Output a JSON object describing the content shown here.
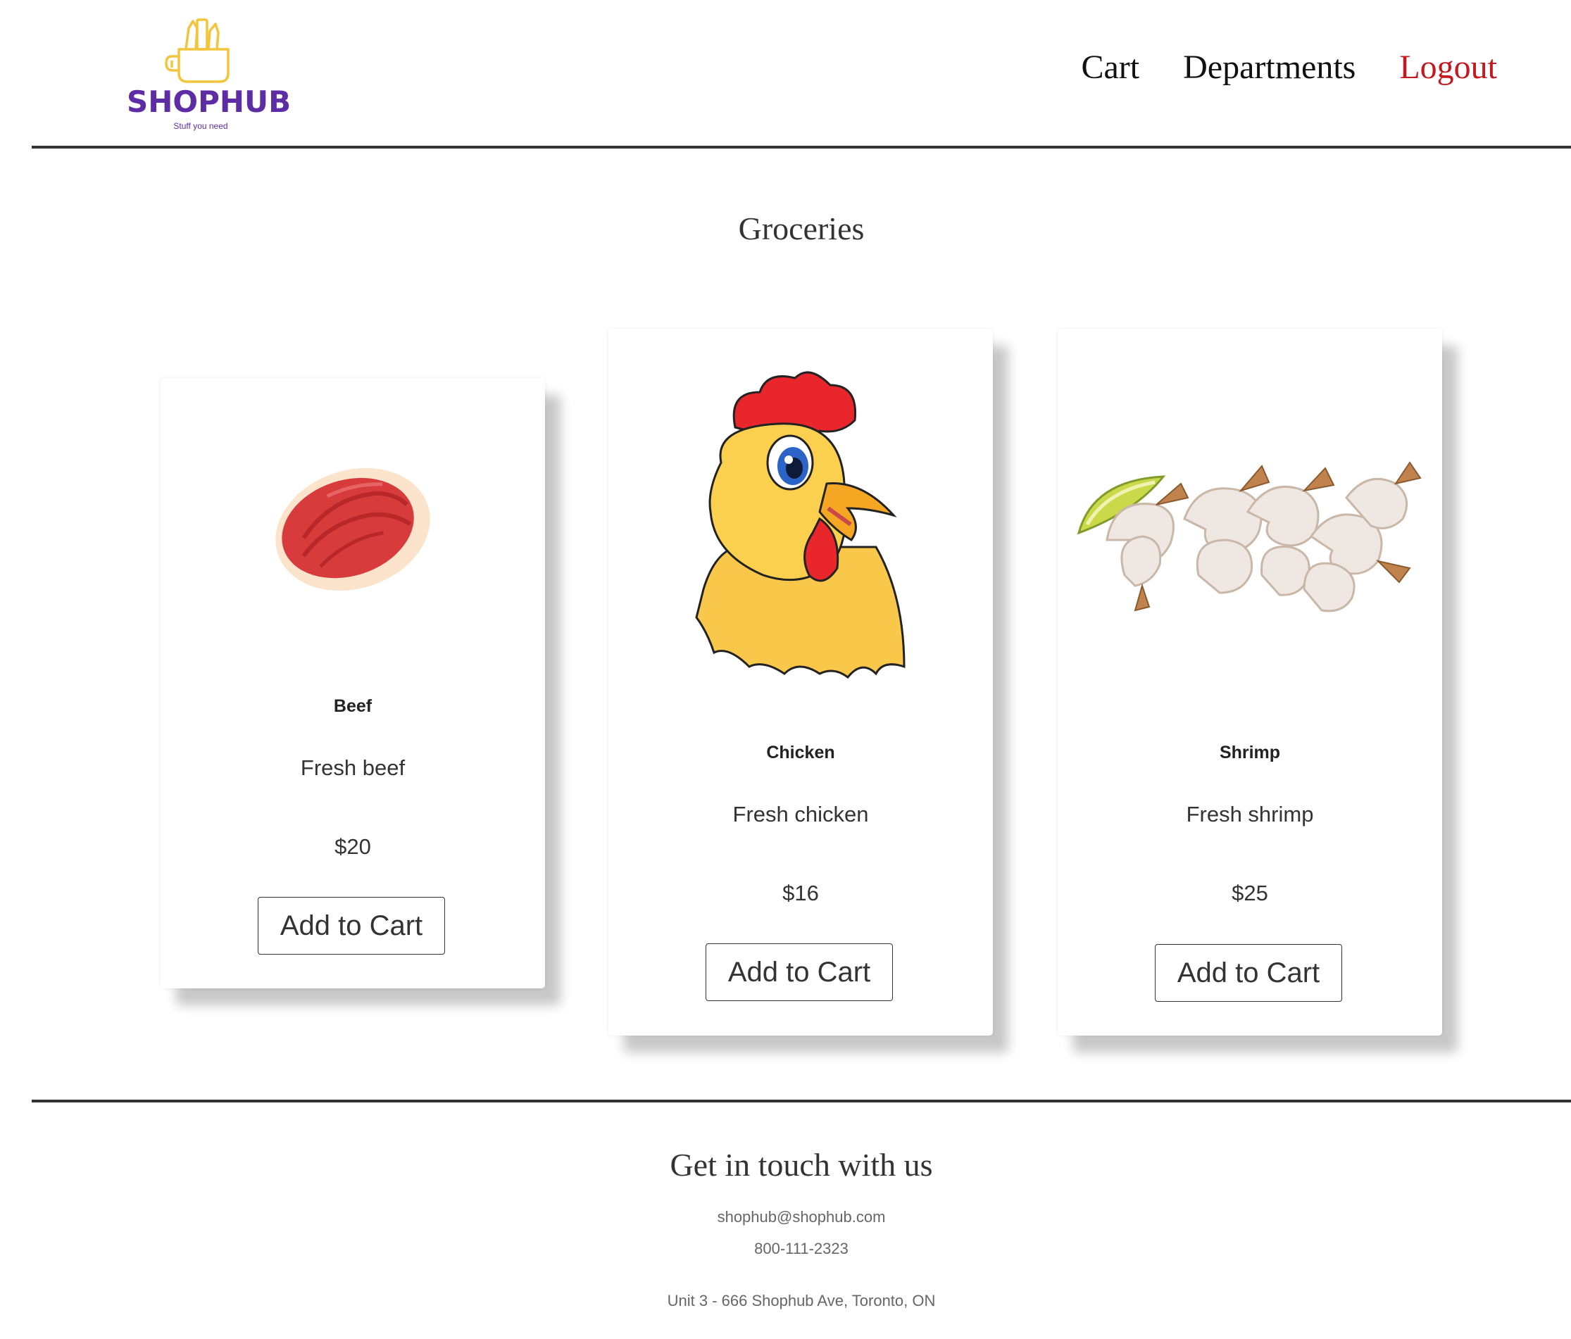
{
  "header": {
    "logo_text": "SHOPHUB",
    "logo_tagline": "Stuff you need",
    "nav": {
      "cart": "Cart",
      "departments": "Departments",
      "logout": "Logout"
    }
  },
  "main": {
    "title": "Groceries",
    "products": [
      {
        "name": "Beef",
        "description": "Fresh beef",
        "price": "$20",
        "button": "Add to Cart",
        "icon": "beef-steak-icon"
      },
      {
        "name": "Chicken",
        "description": "Fresh chicken",
        "price": "$16",
        "button": "Add to Cart",
        "icon": "chicken-cartoon-icon"
      },
      {
        "name": "Shrimp",
        "description": "Fresh shrimp",
        "price": "$25",
        "button": "Add to Cart",
        "icon": "shrimp-photo-icon"
      }
    ]
  },
  "footer": {
    "title": "Get in touch with us",
    "email": "shophub@shophub.com",
    "phone": "800-111-2323",
    "address": "Unit 3 - 666 Shophub Ave, Toronto, ON"
  },
  "colors": {
    "brand_purple": "#5e2ca5",
    "brand_yellow": "#f2c53d",
    "logout_red": "#c3191f",
    "rule": "#333333"
  }
}
